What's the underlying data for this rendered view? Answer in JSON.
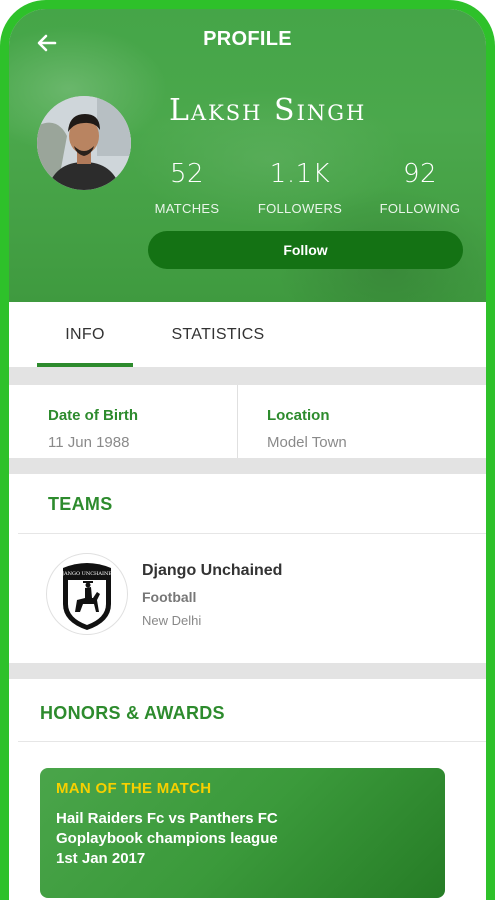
{
  "header": {
    "title": "PROFILE",
    "back_icon": "arrow-left-icon"
  },
  "profile": {
    "name": "Laksh Singh",
    "stats": [
      {
        "value": "52",
        "label": "MATCHES"
      },
      {
        "value": "1.1K",
        "label": "FOLLOWERS"
      },
      {
        "value": "92",
        "label": "FOLLOWING"
      }
    ],
    "follow_label": "Follow"
  },
  "tabs": [
    {
      "label": "INFO",
      "active": true
    },
    {
      "label": "STATISTICS",
      "active": false
    }
  ],
  "info": {
    "dob_label": "Date of Birth",
    "dob_value": "11 Jun 1988",
    "location_label": "Location",
    "location_value": "Model Town"
  },
  "teams": {
    "title": "TEAMS",
    "items": [
      {
        "name": "Django Unchained",
        "sport": "Football",
        "city": "New Delhi",
        "logo_text": "DJANGO UNCHAINED"
      }
    ]
  },
  "honors": {
    "title": "HONORS & AWARDS",
    "items": [
      {
        "kicker": "MAN OF THE MATCH",
        "match": "Hail Raiders Fc vs Panthers FC",
        "league": "Goplaybook champions league",
        "date": "1st Jan 2017"
      }
    ]
  },
  "colors": {
    "frame": "#2ec12a",
    "accent_green": "#2d8b2d",
    "follow_button": "#147214",
    "award_kicker": "#f7d000"
  }
}
